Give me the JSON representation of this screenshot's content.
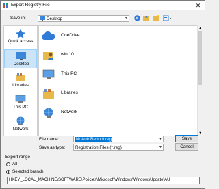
{
  "window": {
    "title": "Export Registry File"
  },
  "save_in": {
    "label": "Save in:",
    "value": "Desktop"
  },
  "places": [
    {
      "label": "Quick access",
      "icon": "star-icon"
    },
    {
      "label": "Desktop",
      "icon": "desktop-icon"
    },
    {
      "label": "Libraries",
      "icon": "libraries-icon"
    },
    {
      "label": "This PC",
      "icon": "computer-icon"
    },
    {
      "label": "Network",
      "icon": "network-icon"
    }
  ],
  "files": [
    {
      "name": "OneDrive",
      "icon": "cloud-icon"
    },
    {
      "name": "win 10",
      "icon": "user-folder-icon"
    },
    {
      "name": "This PC",
      "icon": "computer-icon"
    },
    {
      "name": "Libraries",
      "icon": "libraries-icon"
    },
    {
      "name": "Network",
      "icon": "network-icon"
    }
  ],
  "file_name": {
    "label": "File name:",
    "value": "NoAutoReboot.reg"
  },
  "save_type": {
    "label": "Save as type:",
    "value": "Registration Files (*.reg)"
  },
  "buttons": {
    "save": "Save",
    "cancel": "Cancel"
  },
  "export_range": {
    "label": "Export range",
    "all": "All",
    "selected": "Selected branch",
    "branch": "HKEY_LOCAL_MACHINE\\SOFTWARE\\Policies\\Microsoft\\Windows\\WindowsUpdate\\AU"
  }
}
